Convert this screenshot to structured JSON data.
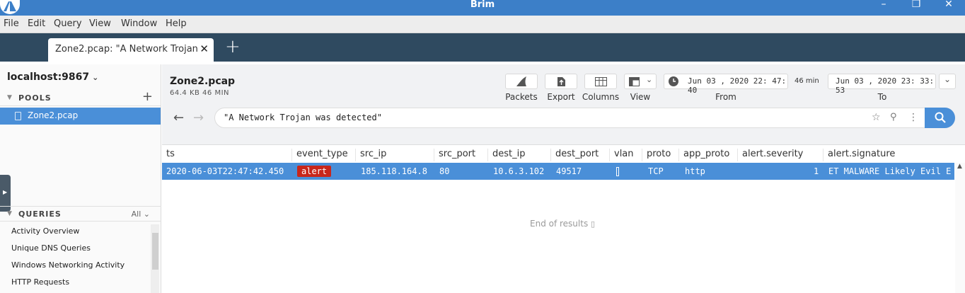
{
  "window": {
    "title": "Brim"
  },
  "menu": [
    "File",
    "Edit",
    "Query",
    "View",
    "Window",
    "Help"
  ],
  "tabs": [
    {
      "label": "Zone2.pcap: \"A Network Trojan ...",
      "active": true
    }
  ],
  "sidebar": {
    "host": "localhost:9867",
    "pools_label": "POOLS",
    "pools": [
      {
        "name": "Zone2.pcap",
        "selected": true
      }
    ],
    "queries_label": "QUERIES",
    "queries_filter": "All",
    "queries": [
      "Activity Overview",
      "Unique DNS Queries",
      "Windows Networking Activity",
      "HTTP Requests"
    ]
  },
  "pool_header": {
    "name": "Zone2.pcap",
    "meta": "64.4 KB   46 MIN"
  },
  "toolbar": {
    "packets": "Packets",
    "export": "Export",
    "columns": "Columns",
    "view": "View",
    "from_value": "Jun 03 , 2020  22: 47: 40",
    "from_label": "From",
    "duration": "46 min",
    "to_value": "Jun 03 , 2020  23: 33: 53",
    "to_label": "To"
  },
  "search": {
    "query": "\"A Network Trojan was detected\""
  },
  "table": {
    "columns": [
      "ts",
      "event_type",
      "src_ip",
      "src_port",
      "dest_ip",
      "dest_port",
      "vlan",
      "proto",
      "app_proto",
      "alert.severity",
      "alert.signature"
    ],
    "rows": [
      {
        "ts": "2020-06-03T22:47:42.450",
        "event_type": "alert",
        "src_ip": "185.118.164.8",
        "src_port": "80",
        "dest_ip": "10.6.3.102",
        "dest_port": "49517",
        "vlan": "",
        "proto": "TCP",
        "app_proto": "http",
        "alert_severity": "1",
        "alert_signature": "ET MALWARE Likely Evil E"
      }
    ],
    "end_text": "End of results"
  },
  "colors": {
    "accent": "#4a8fd8",
    "titlebar": "#3c7fc8",
    "tabbar": "#2f4a60",
    "alert": "#c8261b"
  }
}
